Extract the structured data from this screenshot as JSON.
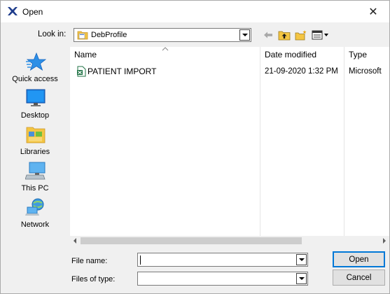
{
  "window": {
    "title": "Open",
    "close_symbol": "✕"
  },
  "toolbar": {
    "look_in_label": "Look in:",
    "look_in_value": "DebProfile",
    "buttons": [
      "back-arrow-icon",
      "up-folder-icon",
      "new-folder-icon",
      "view-menu-icon"
    ]
  },
  "places": [
    {
      "label": "Quick access",
      "icon": "quick-access-star-icon"
    },
    {
      "label": "Desktop",
      "icon": "desktop-icon"
    },
    {
      "label": "Libraries",
      "icon": "libraries-icon"
    },
    {
      "label": "This PC",
      "icon": "this-pc-icon"
    },
    {
      "label": "Network",
      "icon": "network-icon"
    }
  ],
  "file_list": {
    "columns": {
      "name": "Name",
      "date_modified": "Date modified",
      "type": "Type"
    },
    "rows": [
      {
        "name": "PATIENT IMPORT",
        "date": "21-09-2020 1:32 PM",
        "type": "Microsoft",
        "icon": "excel-file-icon"
      }
    ]
  },
  "form": {
    "file_name_label": "File name:",
    "file_name_value": "",
    "files_of_type_label": "Files of type:",
    "files_of_type_value": ""
  },
  "buttons": {
    "open": "Open",
    "cancel": "Cancel"
  },
  "colors": {
    "accent": "#0078d7",
    "excel_green": "#217346",
    "folder_yellow": "#f4c542"
  }
}
